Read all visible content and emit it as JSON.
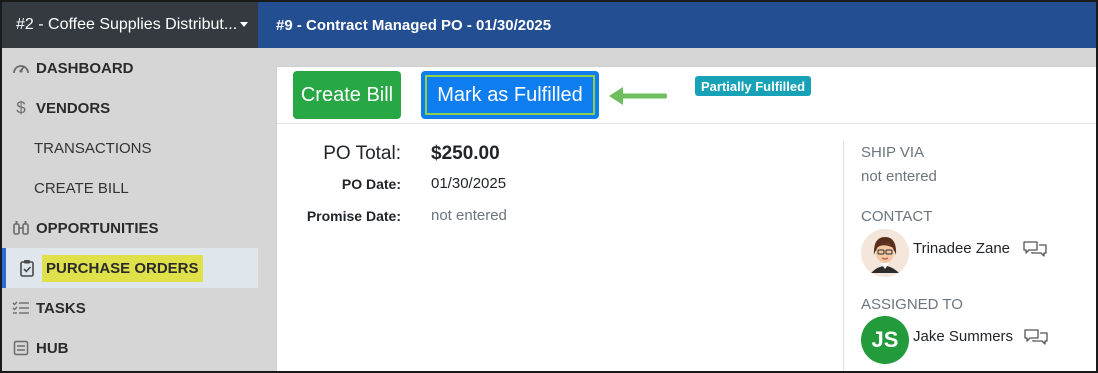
{
  "sidebar": {
    "company": "#2 - Coffee Supplies Distribut...",
    "items": [
      {
        "label": "DASHBOARD",
        "icon": "dashboard-gauge-icon"
      },
      {
        "label": "VENDORS",
        "icon": "dollar-icon"
      },
      {
        "label": "TRANSACTIONS"
      },
      {
        "label": "CREATE BILL"
      },
      {
        "label": "OPPORTUNITIES",
        "icon": "binoculars-icon"
      },
      {
        "label": "PURCHASE ORDERS",
        "icon": "clipboard-check-icon",
        "active": true
      },
      {
        "label": "TASKS",
        "icon": "task-list-icon"
      },
      {
        "label": "HUB",
        "icon": "hub-icon"
      }
    ]
  },
  "header": {
    "title": "#9 - Contract Managed PO - 01/30/2025"
  },
  "toolbar": {
    "create_bill": "Create Bill",
    "mark_fulfilled": "Mark as Fulfilled",
    "status_badge": "Partially Fulfilled"
  },
  "details": {
    "po_total_label": "PO Total:",
    "po_total_value": "$250.00",
    "po_date_label": "PO Date:",
    "po_date_value": "01/30/2025",
    "promise_date_label": "Promise Date:",
    "promise_date_value": "not entered"
  },
  "right_panel": {
    "ship_via_label": "SHIP VIA",
    "ship_via_value": "not entered",
    "contact_label": "CONTACT",
    "contact_name": "Trinadee Zane",
    "assigned_label": "ASSIGNED TO",
    "assigned_initials": "JS",
    "assigned_name": "Jake Summers"
  },
  "colors": {
    "sidebar_bg": "#d6d6d6",
    "company_bar": "#343a40",
    "header_bg": "#234e92",
    "create_bill": "#28a745",
    "mark_fulfilled": "#0d7df0",
    "badge": "#17a2b8",
    "arrow": "#6cbf5c",
    "highlight": "#dfe04a",
    "avatar_js": "#239b3a"
  }
}
